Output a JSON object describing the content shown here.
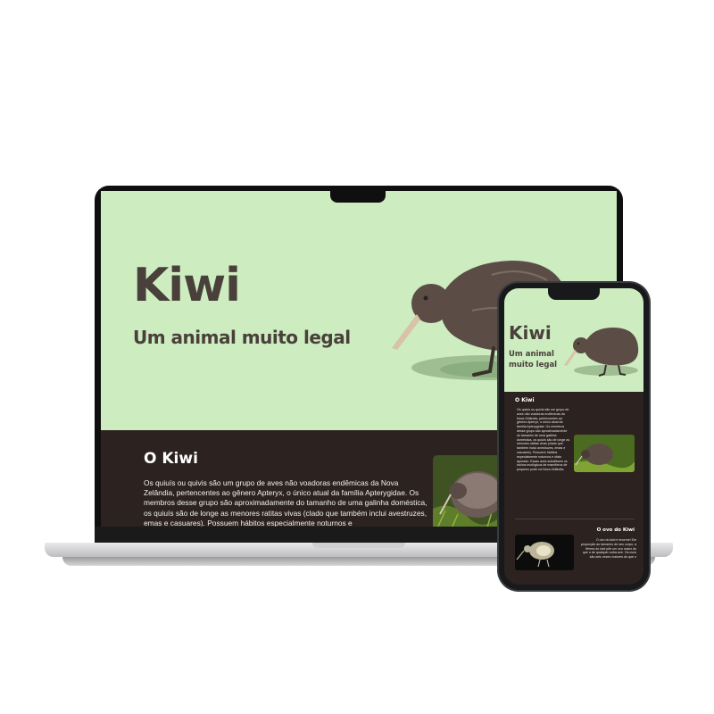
{
  "site": {
    "hero": {
      "title": "Kiwi",
      "subtitle": "Um animal muito legal",
      "illustration": "kiwi-bird-illustration"
    },
    "section_kiwi": {
      "title": "O Kiwi",
      "text": "Os quiuís ou quivis são um grupo de aves não voadoras endêmicas da Nova Zelândia, pertencentes ao gênero Apteryx, o único atual da família Apterygidae. Os membros desse grupo são aproximadamente do tamanho de uma galinha doméstica, os quiuís são de longe as menores ratitas vivas (clado que também inclui avestruzes, emas e casuares). Possuem hábitos especialmente noturnos e",
      "photo": "kiwi-photo"
    }
  },
  "mobile": {
    "hero": {
      "title": "Kiwi",
      "subtitle": "Um animal muito legal"
    },
    "section_kiwi": {
      "title": "O Kiwi",
      "text": "Os quiuís ou quivis são um grupo de aves não voadoras endêmicas da Nova Zelândia, pertencentes ao gênero Apteryx, o único atual da família Apterygidae. Os membros desse grupo são aproximadamente do tamanho de uma galinha doméstica, os quiuís são de longe as menores ratitas vivas (clado que também inclui avestruzes, emas e casuares). Possuem hábitos especialmente noturnos e ofato apurado. Essas aves substituem os nichos ecológicos de mamíferos de pequeno porte na Nova Zelândia."
    },
    "section_egg": {
      "title": "O ovo do Kiwi",
      "text": "O ovo do kiwi é enorme! Em proporção ao tamanho de seu corpo, a fêmea do kiwi põe um ovo maior do que o de qualquer outra ave. Os ovos são seis vezes maiores do que o"
    }
  },
  "colors": {
    "hero_bg": "#cdecc0",
    "title_text": "#4a403b",
    "section_bg": "#2c2220",
    "kiwi_body": "#5b4d45"
  }
}
